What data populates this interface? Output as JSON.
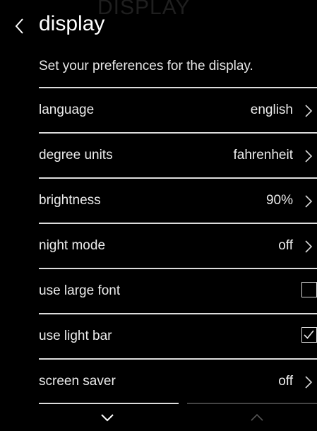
{
  "watermark": "DISPLAY",
  "header": {
    "back_icon": "chevron-left-icon",
    "title": "display"
  },
  "subtitle": "Set your preferences for the display.",
  "settings": [
    {
      "label": "language",
      "value": "english",
      "control": "chevron-right-icon"
    },
    {
      "label": "degree units",
      "value": "fahrenheit",
      "control": "chevron-right-icon"
    },
    {
      "label": "brightness",
      "value": "90%",
      "control": "chevron-right-icon"
    },
    {
      "label": "night mode",
      "value": "off",
      "control": "chevron-right-icon"
    },
    {
      "label": "use large font",
      "checked": false,
      "control": "checkbox"
    },
    {
      "label": "use light bar",
      "checked": true,
      "control": "checkbox"
    },
    {
      "label": "screen saver",
      "value": "off",
      "control": "chevron-right-icon"
    }
  ],
  "footer": {
    "scroll_down_icon": "chevron-down-icon",
    "scroll_up_icon": "chevron-up-icon",
    "scroll_up_enabled": false
  },
  "colors": {
    "background": "#000000",
    "text": "#ffffff",
    "divider": "#dcdcdc",
    "disabled": "#555555"
  }
}
